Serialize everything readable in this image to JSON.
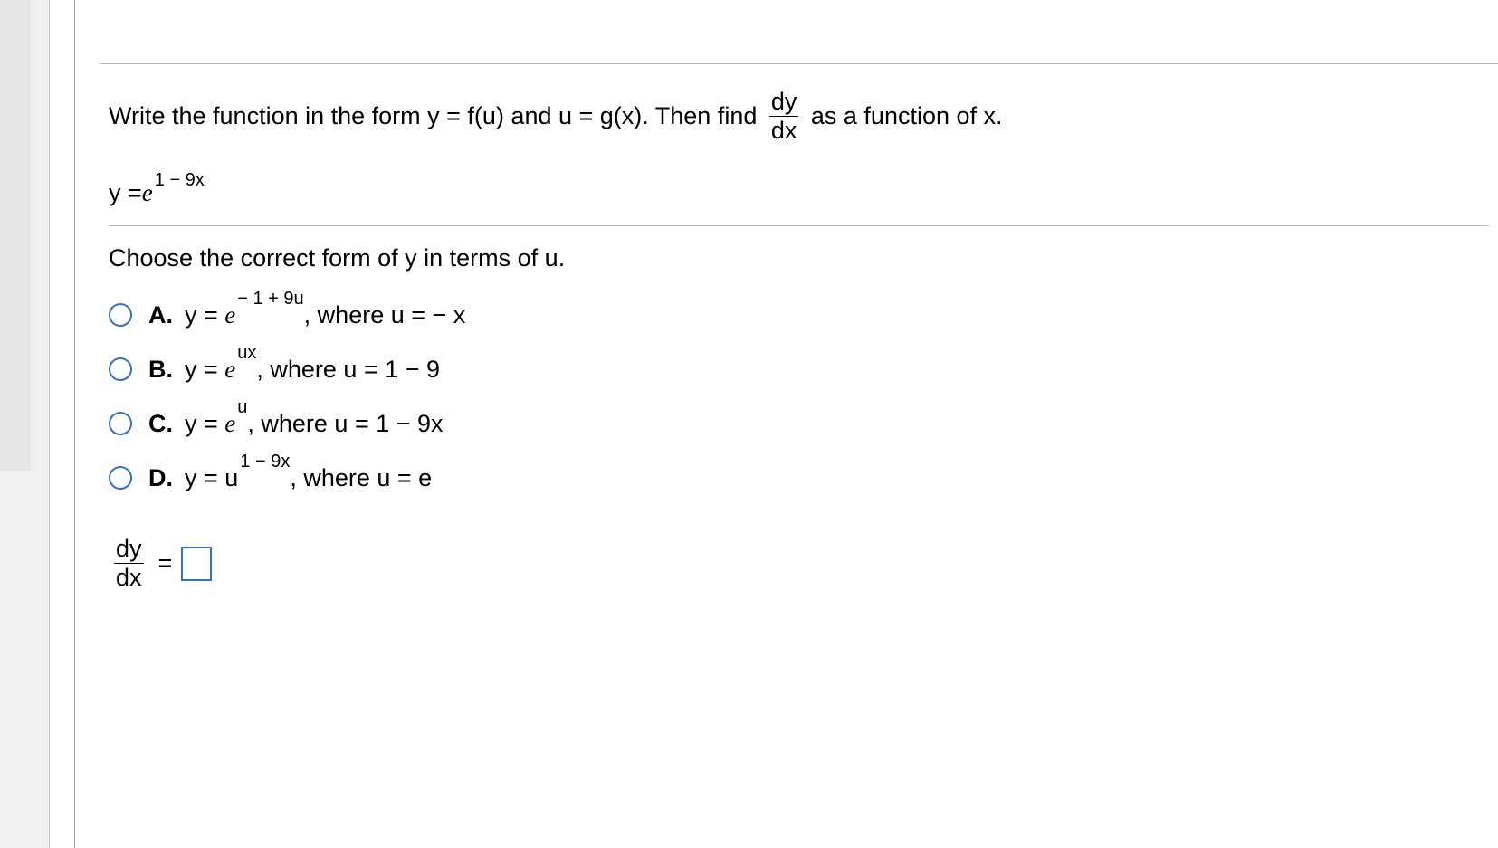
{
  "prompt": {
    "part1": "Write the function in the form y = f(u) and u = g(x). Then find ",
    "frac_num": "dy",
    "frac_den": "dx",
    "part2": " as a function of x."
  },
  "given": {
    "lhs": "y = ",
    "e": "e",
    "exp": "1 − 9x"
  },
  "sub_prompt": "Choose the correct form of y in terms of u.",
  "choices": [
    {
      "label": "A.",
      "pre": "y = ",
      "e": "e",
      "exp": " − 1 + 9u",
      "post": ", where u = − x"
    },
    {
      "label": "B.",
      "pre": "y = ",
      "e": "e",
      "exp": " ux",
      "post": ", where u = 1 − 9"
    },
    {
      "label": "C.",
      "pre": "y = ",
      "e": "e",
      "exp": " u",
      "post": ", where u = 1 − 9x"
    },
    {
      "label": "D.",
      "pre": "y = u",
      "e": "",
      "exp": "1 − 9x",
      "post": ", where u = e"
    }
  ],
  "answer": {
    "frac_num": "dy",
    "frac_den": "dx",
    "eq": "="
  }
}
